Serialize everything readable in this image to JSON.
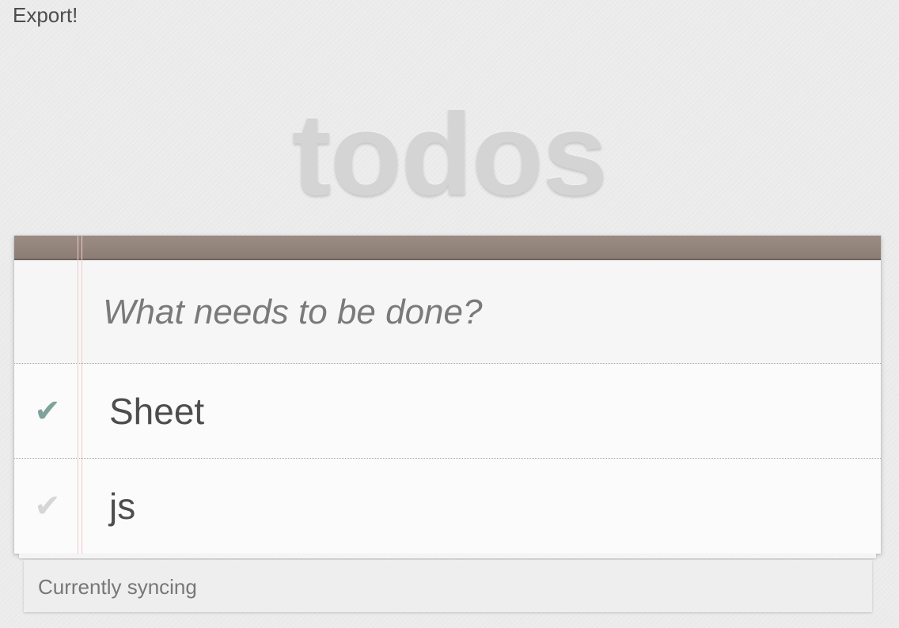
{
  "header": {
    "export_label": "Export!",
    "app_title": "todos"
  },
  "new_todo": {
    "placeholder": "What needs to be done?",
    "value": ""
  },
  "todos": [
    {
      "label": "Sheet",
      "checked": true,
      "icon": "checkmark-icon"
    },
    {
      "label": "js",
      "checked": false,
      "icon": "checkmark-icon"
    }
  ],
  "checkmark_glyph": "✔",
  "footer": {
    "status": "Currently syncing"
  },
  "colors": {
    "header_bar": "#8c7d75",
    "checked": "#7fa39a",
    "unchecked": "#d6d6d6",
    "title": "#d4d4d4",
    "margin_line": "#f0c8c8"
  }
}
